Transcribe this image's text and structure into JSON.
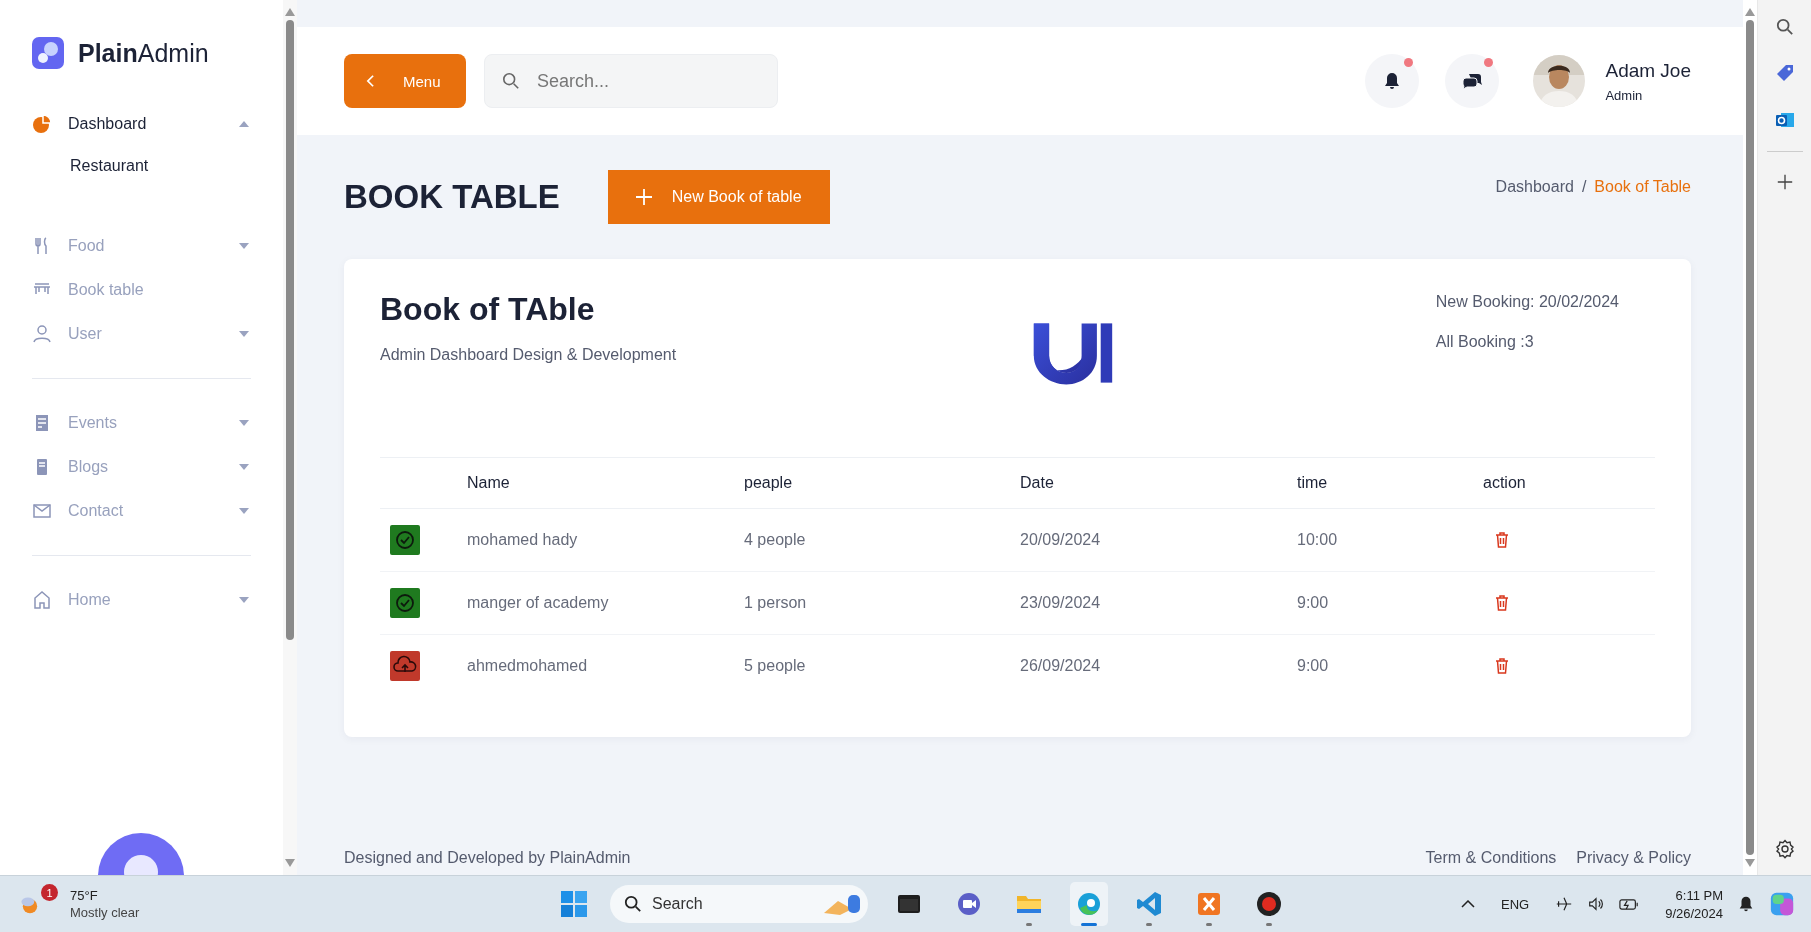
{
  "sidebar": {
    "logo": "**Plain**Admin",
    "sections": [
      {
        "items": [
          {
            "kind": "pie",
            "label": "Dashboard",
            "submenu": true,
            "selected": true,
            "expanded": true,
            "children": [
              {
                "label": "Restaurant"
              }
            ]
          }
        ]
      },
      {
        "items": [
          {
            "kind": "cutlery",
            "label": "Food",
            "submenu": true,
            "selected": false,
            "expanded": false
          },
          {
            "kind": "table",
            "label": "Book table",
            "selected": false
          },
          {
            "kind": "user",
            "label": "User",
            "submenu": true,
            "selected": false,
            "expanded": false
          }
        ]
      },
      {
        "items": [
          {
            "kind": "events",
            "label": "Events",
            "submenu": true,
            "selected": false,
            "expanded": false
          },
          {
            "kind": "blog",
            "label": "Blogs",
            "submenu": true,
            "selected": false,
            "expanded": false
          },
          {
            "kind": "mail",
            "label": "Contact",
            "submenu": true,
            "selected": false,
            "expanded": false
          }
        ]
      },
      {
        "items": [
          {
            "kind": "home",
            "label": "Home",
            "submenu": true,
            "selected": false,
            "expanded": false
          }
        ]
      }
    ]
  },
  "header": {
    "menu_button": "Menu",
    "search": {
      "placeholder": "Search..."
    },
    "notifications": [
      {
        "kind": "bell",
        "unread": true
      },
      {
        "kind": "chat",
        "unread": true
      }
    ],
    "user": {
      "name": "Adam Joe",
      "role": "Admin"
    }
  },
  "page": {
    "title": "BOOK TABLE",
    "new_button": "New Book of table",
    "breadcrumb": [
      {
        "label": "Dashboard",
        "selected": false
      },
      {
        "separator": "/",
        "label": "Book of Table",
        "selected": true
      }
    ]
  },
  "card": {
    "title": "Book of TAble",
    "subtitle": "Admin Dashboard Design & Development",
    "stats": [
      "New Booking: 20/02/2024",
      "All Booking :3"
    ],
    "table": {
      "columns": [
        "Name",
        "peaple",
        "Date",
        "time",
        "action"
      ],
      "rows": [
        {
          "kind": "confirmed",
          "name": "mohamed hady",
          "people": "4 people",
          "date": "20/09/2024",
          "time": "10:00"
        },
        {
          "kind": "confirmed",
          "name": "manger of academy",
          "people": "1 person",
          "date": "23/09/2024",
          "time": "9:00"
        },
        {
          "kind": "pending",
          "name": "ahmedmohamed",
          "people": "5 people",
          "date": "26/09/2024",
          "time": "9:00"
        }
      ]
    }
  },
  "footer": {
    "credit": "Designed and Developed by PlainAdmin",
    "links": [
      "Term & Conditions",
      "Privacy & Policy"
    ]
  },
  "taskbar": {
    "weather": {
      "badge": "1",
      "temperature": "75°F",
      "condition": "Mostly clear"
    },
    "search": {
      "placeholder": "Search"
    },
    "apps": [
      {
        "kind": "terminal",
        "running": false,
        "selected": false
      },
      {
        "kind": "meet",
        "running": false,
        "selected": false
      },
      {
        "kind": "folder",
        "running": true,
        "selected": false
      },
      {
        "kind": "edge",
        "running": true,
        "selected": true
      },
      {
        "kind": "vscode",
        "running": true,
        "selected": false
      },
      {
        "kind": "xampp",
        "running": true,
        "selected": false
      },
      {
        "kind": "record",
        "running": true,
        "selected": false
      }
    ],
    "language": "ENG",
    "time": "6:11 PM",
    "date": "9/26/2024"
  }
}
